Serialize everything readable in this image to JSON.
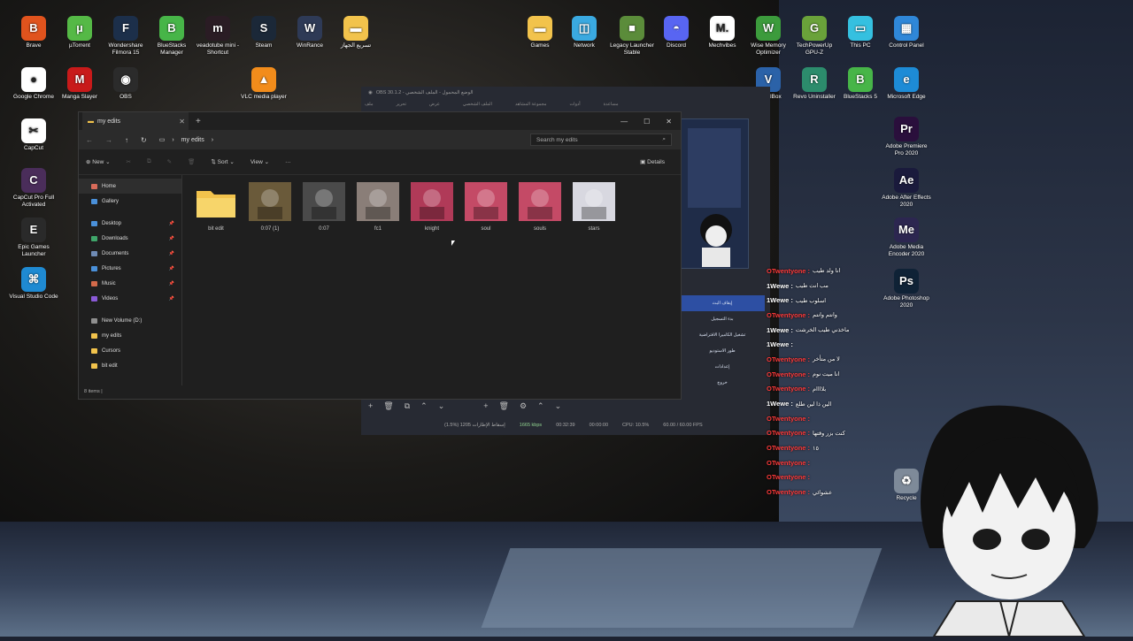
{
  "desktop": {
    "icons_left": [
      {
        "label": "Brave",
        "color": "#e0531d",
        "glyph": "B"
      },
      {
        "label": "µTorrent",
        "color": "#55b946",
        "glyph": "µ"
      },
      {
        "label": "Wondershare Filmora 15",
        "color": "#1c2f4a",
        "glyph": "F"
      },
      {
        "label": "BlueStacks Manager",
        "color": "#47b548",
        "glyph": "B"
      },
      {
        "label": "veadotube mini - Shortcut",
        "color": "#2a1c24",
        "glyph": "m"
      },
      {
        "label": "Steam",
        "color": "#1b2838",
        "glyph": "S"
      },
      {
        "label": "WinRance",
        "color": "#2e3a56",
        "glyph": "W"
      },
      {
        "label": "تسريع الجهاز",
        "color": "#f2c34c",
        "glyph": "▬"
      },
      {
        "label": "Google Chrome",
        "color": "#ffffff",
        "glyph": "●"
      },
      {
        "label": "Manga Slayer",
        "color": "#c81a1a",
        "glyph": "M"
      },
      {
        "label": "OBS",
        "color": "#2b2b2b",
        "glyph": "◉"
      },
      {
        "label": "VLC media player",
        "color": "#f28c1b",
        "glyph": "▲"
      },
      {
        "label": "CapCut",
        "color": "#ffffff",
        "glyph": "✂"
      },
      {
        "label": "CapCut Pro Full Activated",
        "color": "#4a2d5a",
        "glyph": "C"
      },
      {
        "label": "Epic Games Launcher",
        "color": "#2a2a2a",
        "glyph": "E"
      },
      {
        "label": "Visual Studio Code",
        "color": "#1f8ad2",
        "glyph": "⌘"
      }
    ],
    "icons_right": [
      {
        "label": "Games",
        "color": "#f2c34c",
        "glyph": "▬"
      },
      {
        "label": "Network",
        "color": "#3aa9e0",
        "glyph": "◫"
      },
      {
        "label": "Legacy Launcher Stable",
        "color": "#5b8c3a",
        "glyph": "■"
      },
      {
        "label": "Discord",
        "color": "#5865f2",
        "glyph": "◓"
      },
      {
        "label": "Mechvibes",
        "color": "#ffffff",
        "glyph": "M."
      },
      {
        "label": "Wise Memory Optimizer",
        "color": "#3c9b3c",
        "glyph": "W"
      },
      {
        "label": "TechPowerUp GPU-Z",
        "color": "#6aa23a",
        "glyph": "G"
      },
      {
        "label": "This PC",
        "color": "#35c0e0",
        "glyph": "▭"
      },
      {
        "label": "Control Panel",
        "color": "#2f87d8",
        "glyph": "▦"
      },
      {
        "label": "VirtualBox",
        "color": "#2b62a8",
        "glyph": "V"
      },
      {
        "label": "Revo Uninstaller",
        "color": "#2c8c6c",
        "glyph": "R"
      },
      {
        "label": "BlueStacks 5",
        "color": "#47b548",
        "glyph": "B"
      },
      {
        "label": "Microsoft Edge",
        "color": "#1d8bd6",
        "glyph": "e"
      },
      {
        "label": "Adobe Premiere Pro 2020",
        "color": "#2a0f3c",
        "glyph": "Pr"
      },
      {
        "label": "Adobe After Effects 2020",
        "color": "#1a1a3c",
        "glyph": "Ae"
      },
      {
        "label": "Adobe Media Encoder 2020",
        "color": "#2c2650",
        "glyph": "Me"
      },
      {
        "label": "Adobe Photoshop 2020",
        "color": "#0f2236",
        "glyph": "Ps"
      },
      {
        "label": "Recycle",
        "color": "#7e8a99",
        "glyph": "♻"
      }
    ]
  },
  "explorer": {
    "tab_title": "my edits",
    "new_tab": "+",
    "window_controls": [
      "—",
      "☐",
      "✕"
    ],
    "nav": {
      "back": "←",
      "forward": "→",
      "up": "↑",
      "refresh": "↻"
    },
    "path": [
      "my edits"
    ],
    "search_placeholder": "Search my edits",
    "toolbar": {
      "new": "New",
      "sort": "Sort",
      "view": "View",
      "more": "···",
      "details": "Details"
    },
    "sidebar": [
      {
        "label": "Home",
        "color": "#d86b5a",
        "pinned": false
      },
      {
        "label": "Gallery",
        "color": "#4a90d9",
        "pinned": false
      },
      {
        "label": "Desktop",
        "color": "#4a90d9",
        "pinned": true
      },
      {
        "label": "Downloads",
        "color": "#3fa56a",
        "pinned": true
      },
      {
        "label": "Documents",
        "color": "#6f8bb5",
        "pinned": true
      },
      {
        "label": "Pictures",
        "color": "#4a90d9",
        "pinned": true
      },
      {
        "label": "Music",
        "color": "#d36a4a",
        "pinned": true
      },
      {
        "label": "Videos",
        "color": "#8a5ad6",
        "pinned": true
      },
      {
        "label": "New Volume (D:)",
        "color": "#8f8f8f",
        "pinned": false
      },
      {
        "label": "my edits",
        "color": "#f2c34c",
        "pinned": false
      },
      {
        "label": "Cursors",
        "color": "#f2c34c",
        "pinned": false
      },
      {
        "label": "bit edit",
        "color": "#f2c34c",
        "pinned": false
      }
    ],
    "files": [
      {
        "name": "bit edit",
        "kind": "folder",
        "color": "#f2c34c"
      },
      {
        "name": "0:07 (1)",
        "kind": "thumb",
        "color": "#6a5a3a"
      },
      {
        "name": "0:07",
        "kind": "thumb",
        "color": "#4a4a4a"
      },
      {
        "name": "fc1",
        "kind": "thumb",
        "color": "#8a7e78"
      },
      {
        "name": "knight",
        "kind": "thumb",
        "color": "#b03a58"
      },
      {
        "name": "soul",
        "kind": "thumb",
        "color": "#c44a66"
      },
      {
        "name": "souls",
        "kind": "thumb",
        "color": "#c44a66"
      },
      {
        "name": "stars",
        "kind": "thumb",
        "color": "#d8d8e0"
      }
    ],
    "status": "8 items  |"
  },
  "obs": {
    "title": "OBS 30.1.2 - الوضع المحمول - الملف الشخصي",
    "menu": [
      "ملف",
      "تحرير",
      "عرض",
      "الملف الشخصي",
      "مجموعة المشاهد",
      "أدوات",
      "مساعدة"
    ],
    "scenes": [
      "إيقاف البث",
      "بدء التسجيل",
      "تشغيل الكاميرا الافتراضية",
      "طور الاستوديو",
      "إعدادات",
      "خروج"
    ],
    "status": {
      "dropped": "(1.5%) 1205 إسقاط الإطارات",
      "bitrate": "1665 kbps",
      "live_time": "00:32:39",
      "rec_time": "00:00:00",
      "cpu": "CPU: 10.5%",
      "fps": "60.00 / 60.00 FPS"
    }
  },
  "chat": [
    {
      "user": "OTwentyone",
      "msg": "انا ولد طيب",
      "color": "#ff3a3a"
    },
    {
      "user": "1Wewe",
      "msg": "مب انت طيب",
      "color": "#ffffff"
    },
    {
      "user": "1Wewe",
      "msg": "اسلوب طيب",
      "color": "#ffffff"
    },
    {
      "user": "OTwentyone",
      "msg": "وانتم وانتم",
      "color": "#ff3a3a"
    },
    {
      "user": "1Wewe",
      "msg": "ماخذني طيب الخرشت",
      "color": "#ffffff"
    },
    {
      "user": "1Wewe",
      "msg": "",
      "color": "#ffffff"
    },
    {
      "user": "OTwentyone",
      "msg": "لا من متأخر",
      "color": "#ff3a3a"
    },
    {
      "user": "OTwentyone",
      "msg": "انا ميت نوم",
      "color": "#ff3a3a"
    },
    {
      "user": "OTwentyone",
      "msg": "بلاااام",
      "color": "#ff3a3a"
    },
    {
      "user": "1Wewe",
      "msg": "الين ذا لين طلع",
      "color": "#ffffff"
    },
    {
      "user": "OTwentyone",
      "msg": "",
      "color": "#ff3a3a"
    },
    {
      "user": "OTwentyone",
      "msg": "كنت بزر وقتها",
      "color": "#ff3a3a"
    },
    {
      "user": "OTwentyone",
      "msg": "١٥",
      "color": "#ff3a3a"
    },
    {
      "user": "OTwentyone",
      "msg": "",
      "color": "#ff3a3a"
    },
    {
      "user": "OTwentyone",
      "msg": "",
      "color": "#ff3a3a"
    },
    {
      "user": "OTwentyone",
      "msg": "عشوائي",
      "color": "#ff3a3a"
    }
  ]
}
